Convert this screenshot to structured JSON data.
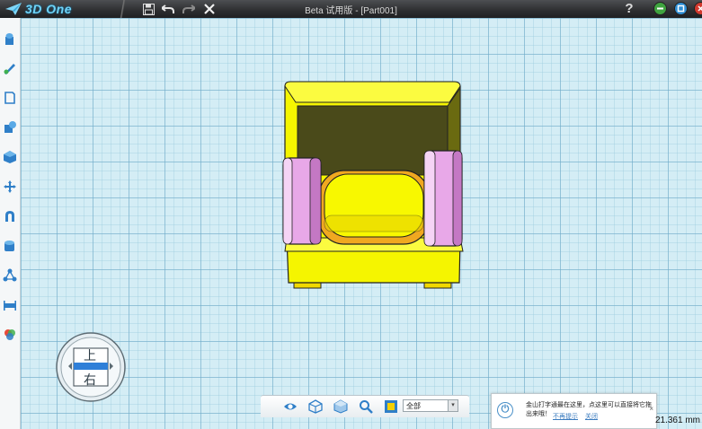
{
  "app": {
    "logo_text": "3D One",
    "window_title": "Beta 试用版 - [Part001]",
    "help_label": "?"
  },
  "quick_access": [
    {
      "name": "save-icon",
      "glyph": "💾"
    },
    {
      "name": "undo-icon",
      "glyph": "↶"
    },
    {
      "name": "redo-icon",
      "glyph": "↷"
    },
    {
      "name": "close-icon",
      "glyph": "✕"
    }
  ],
  "window_buttons": [
    {
      "name": "minimize-button",
      "color": "#3fa33f"
    },
    {
      "name": "restore-button",
      "color": "#2f8fd6"
    },
    {
      "name": "close-window-button",
      "color": "#d33a2f"
    }
  ],
  "view_cube": {
    "top_label": "上",
    "front_label": "右",
    "front_color": "#2f7fd8"
  },
  "bottom_toolbar": {
    "display_filter": "全部"
  },
  "notification": {
    "message": "金山打字通最在这里，点这里可以直接将它拖出来哦！",
    "link_1": "不再提示",
    "link_2": "关闭",
    "close": "×"
  },
  "status": {
    "measurement": "21.361 mm"
  },
  "colors": {
    "model_yellow": "#f5f500",
    "model_pink": "#e8a8e8",
    "model_orange": "#f0b020",
    "grid_bg": "#d4edf5"
  }
}
